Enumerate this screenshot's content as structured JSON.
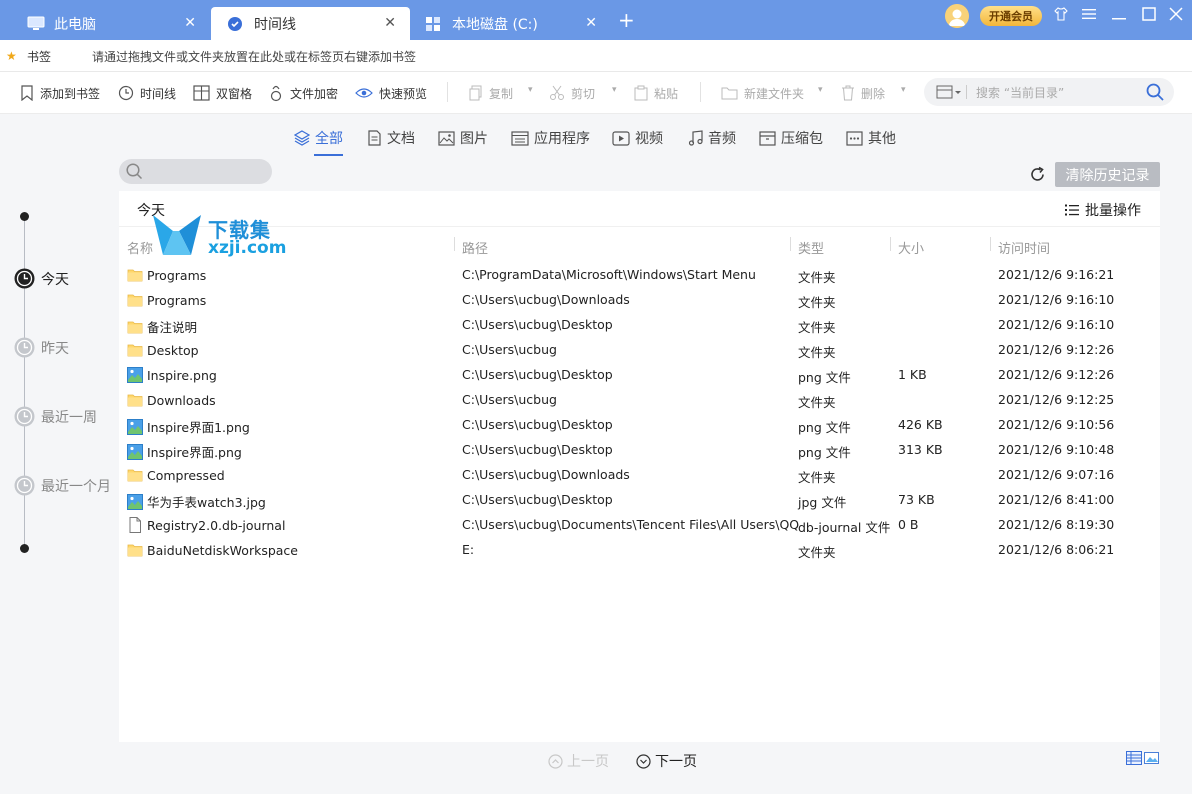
{
  "tabs": [
    {
      "label": "此电脑",
      "icon": "computer-icon"
    },
    {
      "label": "时间线",
      "icon": "timeline-icon",
      "active": true
    },
    {
      "label": "本地磁盘 (C:)",
      "icon": "drive-icon"
    }
  ],
  "header": {
    "vip_label": "开通会员"
  },
  "bookmarks": {
    "label": "书签",
    "hint": "请通过拖拽文件或文件夹放置在此处或在标签页右键添加书签"
  },
  "toolbar": {
    "add_bookmark": "添加到书签",
    "timeline": "时间线",
    "dual_pane": "双窗格",
    "encrypt": "文件加密",
    "quick_preview": "快速预览",
    "copy": "复制",
    "cut": "剪切",
    "paste": "粘贴",
    "new_folder": "新建文件夹",
    "delete": "删除",
    "search_placeholder": "搜索 “当前目录”"
  },
  "categories": [
    {
      "label": "全部",
      "icon": "layers-icon",
      "active": true
    },
    {
      "label": "文档",
      "icon": "document-icon"
    },
    {
      "label": "图片",
      "icon": "image-icon"
    },
    {
      "label": "应用程序",
      "icon": "application-icon"
    },
    {
      "label": "视频",
      "icon": "video-icon"
    },
    {
      "label": "音频",
      "icon": "music-icon"
    },
    {
      "label": "压缩包",
      "icon": "archive-icon"
    },
    {
      "label": "其他",
      "icon": "more-icon"
    }
  ],
  "actions": {
    "clear_history": "清除历史记录",
    "batch": "批量操作"
  },
  "timeline": [
    {
      "label": "今天",
      "active": true
    },
    {
      "label": "昨天"
    },
    {
      "label": "最近一周"
    },
    {
      "label": "最近一个月"
    }
  ],
  "panel": {
    "day_title": "今天"
  },
  "columns": {
    "name": "名称",
    "path": "路径",
    "type": "类型",
    "size": "大小",
    "time": "访问时间"
  },
  "files": [
    {
      "name": "Programs",
      "path": "C:\\ProgramData\\Microsoft\\Windows\\Start Menu",
      "type": "文件夹",
      "size": "",
      "time": "2021/12/6 9:16:21",
      "icon": "folder-icon"
    },
    {
      "name": "Programs",
      "path": "C:\\Users\\ucbug\\Downloads",
      "type": "文件夹",
      "size": "",
      "time": "2021/12/6 9:16:10",
      "icon": "folder-icon"
    },
    {
      "name": "备注说明",
      "path": "C:\\Users\\ucbug\\Desktop",
      "type": "文件夹",
      "size": "",
      "time": "2021/12/6 9:16:10",
      "icon": "folder-icon"
    },
    {
      "name": "Desktop",
      "path": "C:\\Users\\ucbug",
      "type": "文件夹",
      "size": "",
      "time": "2021/12/6 9:12:26",
      "icon": "folder-icon"
    },
    {
      "name": "Inspire.png",
      "path": "C:\\Users\\ucbug\\Desktop",
      "type": "png 文件",
      "size": "1 KB",
      "time": "2021/12/6 9:12:26",
      "icon": "image-file-icon"
    },
    {
      "name": "Downloads",
      "path": "C:\\Users\\ucbug",
      "type": "文件夹",
      "size": "",
      "time": "2021/12/6 9:12:25",
      "icon": "folder-icon"
    },
    {
      "name": "Inspire界面1.png",
      "path": "C:\\Users\\ucbug\\Desktop",
      "type": "png 文件",
      "size": "426 KB",
      "time": "2021/12/6 9:10:56",
      "icon": "image-file-icon"
    },
    {
      "name": "Inspire界面.png",
      "path": "C:\\Users\\ucbug\\Desktop",
      "type": "png 文件",
      "size": "313 KB",
      "time": "2021/12/6 9:10:48",
      "icon": "image-file-icon"
    },
    {
      "name": "Compressed",
      "path": "C:\\Users\\ucbug\\Downloads",
      "type": "文件夹",
      "size": "",
      "time": "2021/12/6 9:07:16",
      "icon": "folder-icon"
    },
    {
      "name": "华为手表watch3.jpg",
      "path": "C:\\Users\\ucbug\\Desktop",
      "type": "jpg 文件",
      "size": "73 KB",
      "time": "2021/12/6 8:41:00",
      "icon": "image-file-icon"
    },
    {
      "name": "Registry2.0.db-journal",
      "path": "C:\\Users\\ucbug\\Documents\\Tencent Files\\All Users\\QQ",
      "type": "db-journal 文件",
      "size": "0 B",
      "time": "2021/12/6 8:19:30",
      "icon": "generic-file-icon"
    },
    {
      "name": "BaiduNetdiskWorkspace",
      "path": "E:",
      "type": "文件夹",
      "size": "",
      "time": "2021/12/6 8:06:21",
      "icon": "folder-icon"
    }
  ],
  "pager": {
    "prev": "上一页",
    "next": "下一页"
  },
  "watermark": {
    "cn": "下载集",
    "en": "xzji.com"
  },
  "colors": {
    "tabbar": "#6a98e6",
    "accent": "#3a6fd8",
    "folder": "#ffd76b"
  }
}
